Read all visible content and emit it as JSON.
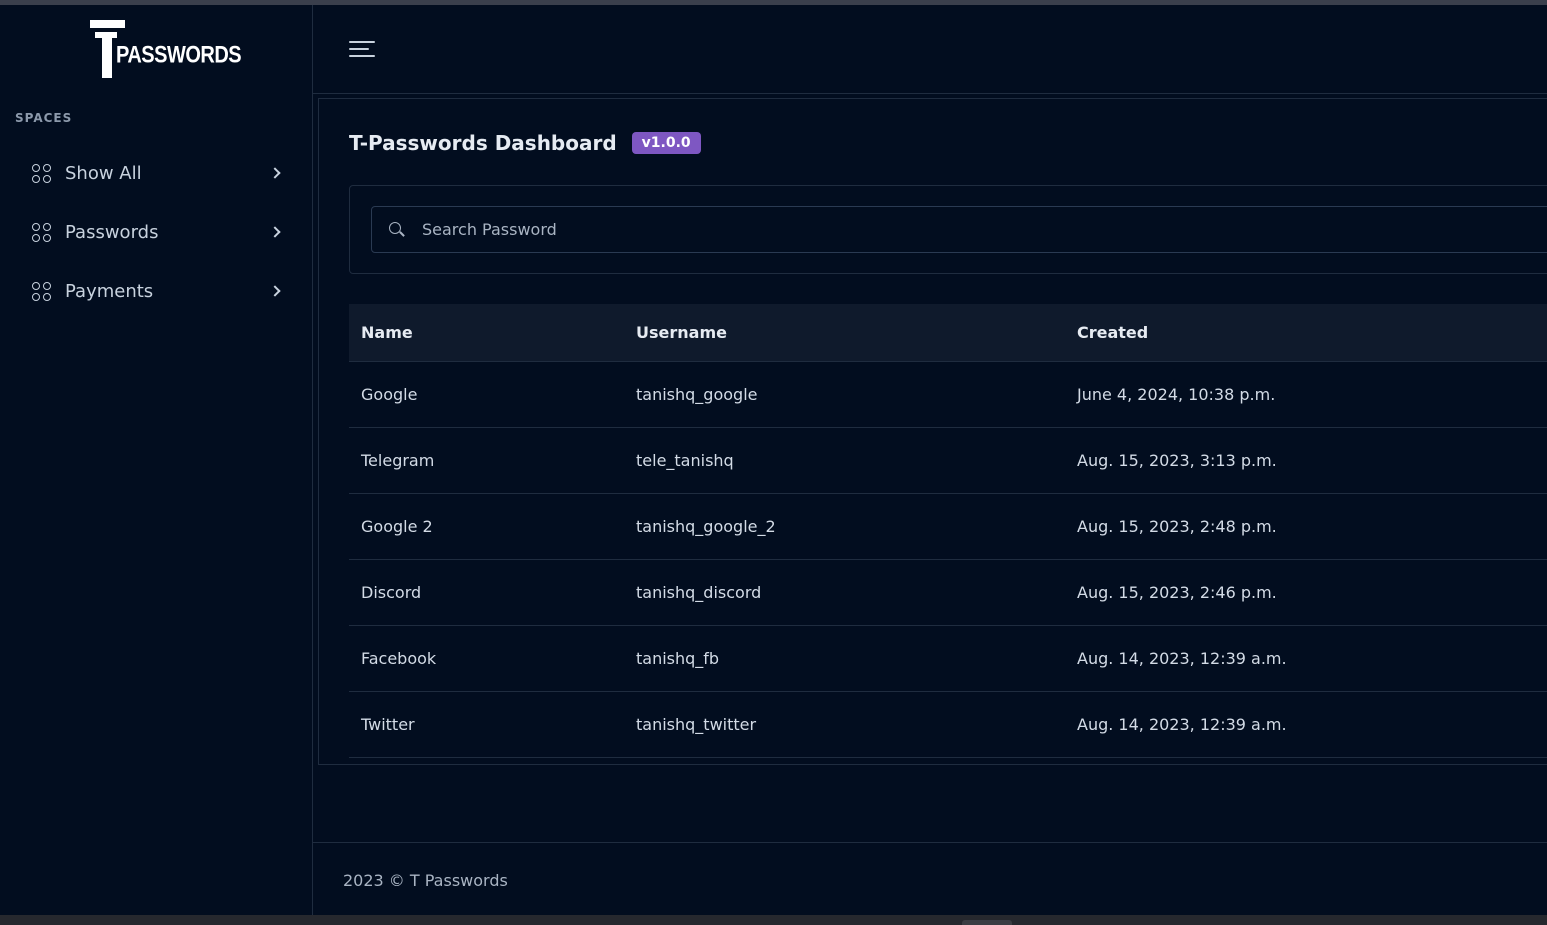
{
  "brand": {
    "logo_text": "PASSWORDS"
  },
  "sidebar": {
    "section_label": "SPACES",
    "items": [
      {
        "label": "Show All"
      },
      {
        "label": "Passwords"
      },
      {
        "label": "Payments"
      }
    ]
  },
  "main": {
    "title": "T-Passwords Dashboard",
    "version": "v1.0.0",
    "search": {
      "placeholder": "Search Password",
      "value": ""
    },
    "table": {
      "headers": [
        "Name",
        "Username",
        "Created"
      ],
      "rows": [
        [
          "Google",
          "tanishq_google",
          "June 4, 2024, 10:38 p.m."
        ],
        [
          "Telegram",
          "tele_tanishq",
          "Aug. 15, 2023, 3:13 p.m."
        ],
        [
          "Google 2",
          "tanishq_google_2",
          "Aug. 15, 2023, 2:48 p.m."
        ],
        [
          "Discord",
          "tanishq_discord",
          "Aug. 15, 2023, 2:46 p.m."
        ],
        [
          "Facebook",
          "tanishq_fb",
          "Aug. 14, 2023, 12:39 a.m."
        ],
        [
          "Twitter",
          "tanishq_twitter",
          "Aug. 14, 2023, 12:39 a.m."
        ]
      ]
    }
  },
  "footer": {
    "text": "2023 © T Passwords"
  },
  "colors": {
    "background": "#020d1f",
    "accent_badge": "#7e57c2",
    "table_header_bg": "#0f1a2c"
  },
  "icons": {
    "nav": "grid-icon",
    "chevron": "chevron-right-icon",
    "menu": "hamburger-menu-icon",
    "search": "search-icon"
  }
}
